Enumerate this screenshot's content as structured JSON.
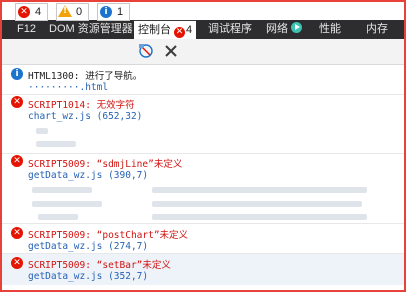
{
  "tabs": [
    {
      "label": "F12"
    },
    {
      "label": "DOM 资源管理器"
    },
    {
      "label": "控制台",
      "badge": "4"
    },
    {
      "label": "调试程序"
    },
    {
      "label": "网络"
    },
    {
      "label": "性能"
    },
    {
      "label": "内存"
    }
  ],
  "toolbar": {
    "errors_count": "4",
    "warnings_count": "0",
    "info_count": "1"
  },
  "console": {
    "info_msg": "HTML1300: 进行了导航。",
    "info_file": "·········.html",
    "e1_msg": "SCRIPT1014: 无效字符",
    "e1_link": "chart_wz.js (652,32)",
    "e2_msg": "SCRIPT5009: “sdmjLine”未定义",
    "e2_link": "getData_wz.js (390,7)",
    "e3_msg": "SCRIPT5009: “postChart”未定义",
    "e3_link": "getData_wz.js (274,7)",
    "e4_msg": "SCRIPT5009: “setBar”未定义",
    "e4_link": "getData_wz.js (352,7)"
  }
}
